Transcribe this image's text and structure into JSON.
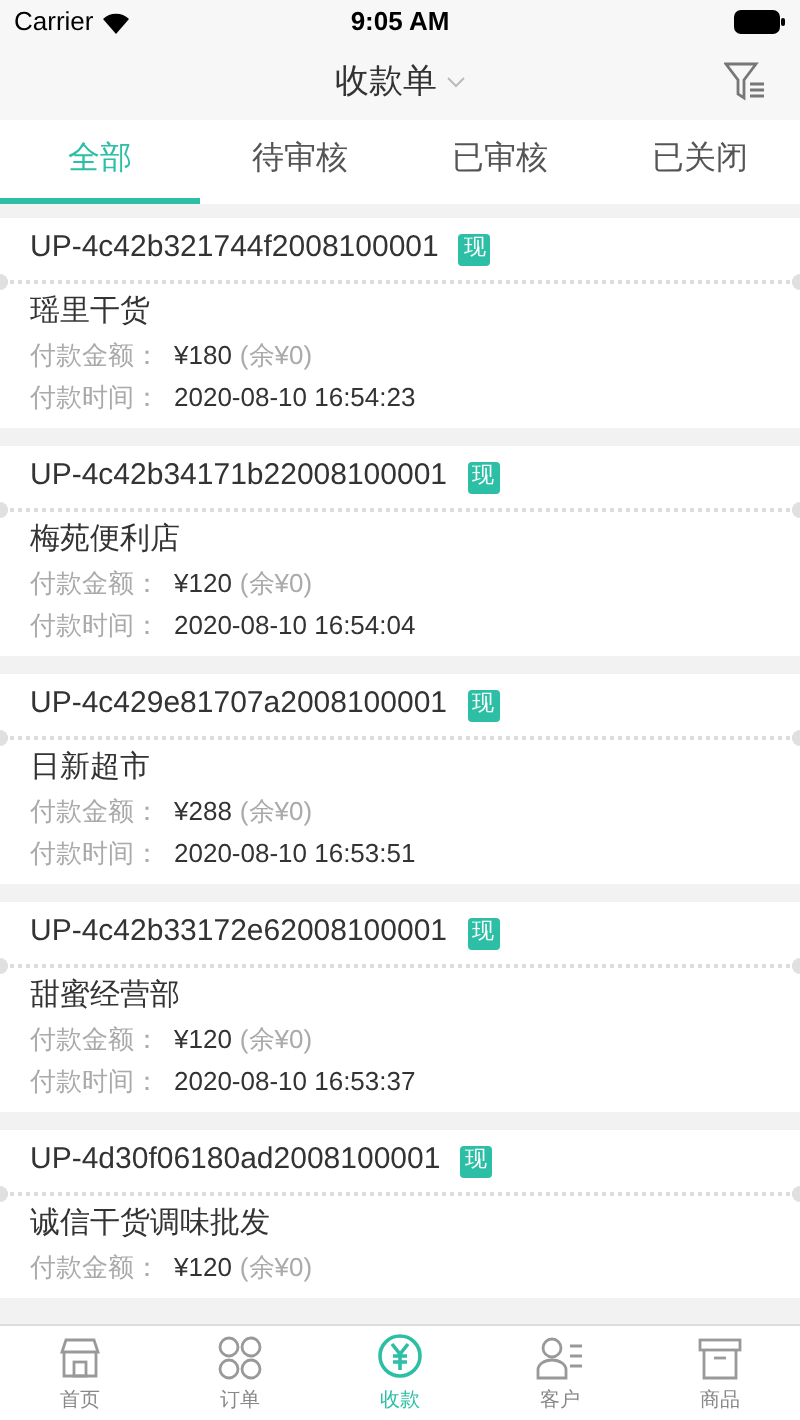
{
  "status_bar": {
    "carrier": "Carrier",
    "time": "9:05 AM"
  },
  "nav": {
    "title": "收款单"
  },
  "tabs": [
    {
      "label": "全部",
      "selected": true
    },
    {
      "label": "待审核",
      "selected": false
    },
    {
      "label": "已审核",
      "selected": false
    },
    {
      "label": "已关闭",
      "selected": false
    }
  ],
  "payments": [
    {
      "number": "UP-4c42b321744f2008100001",
      "badge": "现",
      "store": "瑶里干货",
      "amount_label": "付款金额：",
      "amount": "¥180",
      "remainder": "(余¥0)",
      "time_label": "付款时间：",
      "time": "2020-08-10 16:54:23"
    },
    {
      "number": "UP-4c42b34171b22008100001",
      "badge": "现",
      "store": "梅苑便利店",
      "amount_label": "付款金额：",
      "amount": "¥120",
      "remainder": "(余¥0)",
      "time_label": "付款时间：",
      "time": "2020-08-10 16:54:04"
    },
    {
      "number": "UP-4c429e81707a2008100001",
      "badge": "现",
      "store": "日新超市",
      "amount_label": "付款金额：",
      "amount": "¥288",
      "remainder": "(余¥0)",
      "time_label": "付款时间：",
      "time": "2020-08-10 16:53:51"
    },
    {
      "number": "UP-4c42b33172e62008100001",
      "badge": "现",
      "store": "甜蜜经营部",
      "amount_label": "付款金额：",
      "amount": "¥120",
      "remainder": "(余¥0)",
      "time_label": "付款时间：",
      "time": "2020-08-10 16:53:37"
    },
    {
      "number": "UP-4d30f06180ad2008100001",
      "badge": "现",
      "store": "诚信干货调味批发",
      "amount_label": "付款金额：",
      "amount": "¥120",
      "remainder": "(余¥0)"
    }
  ],
  "tab_bar": [
    {
      "kind": "home",
      "label": "首页",
      "selected": false
    },
    {
      "kind": "orders",
      "label": "订单",
      "selected": false
    },
    {
      "kind": "payments",
      "label": "收款",
      "selected": true
    },
    {
      "kind": "customers",
      "label": "客户",
      "selected": false
    },
    {
      "kind": "products",
      "label": "商品",
      "selected": false
    }
  ]
}
